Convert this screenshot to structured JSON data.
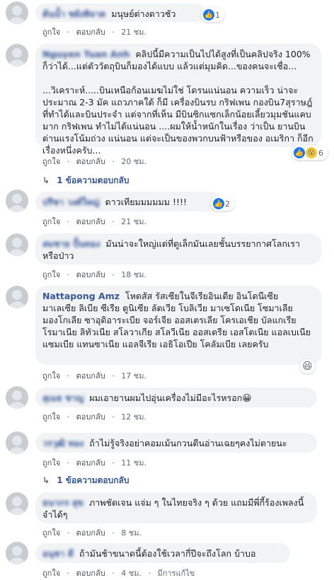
{
  "comments": [
    {
      "author": "ต้นน้ำ ชยังพิจาต",
      "text": "มนุษย์ต่างดาวชัว",
      "time": "21 ชม.",
      "reaction_count": "1"
    },
    {
      "author": "Nguyen Tuan Anh",
      "text": "คลิปนี้มีความเป็นไปได้สูงที่เป็นคลิปจริง 100% ก็ว่าได้...แต่ตัววัตถุบินก็มองได้แบบ แล้วแต่มุมคิด...ของคนจะเชื่อ...\n\n...วิเคราะห์.....บินเหนือก้อนเมฆไม่ใช่ โดรนแน่นอน ความเร็ว น่าจะประมาณ 2-3 มัค แถวภาคใต้ ก็มี เครื่องบินรบ กริฟเพน กองบิน7สุราษฎ์ ที่ทำได้และบินประจำ แต่จากที่เห็น มีบินซิกแซกเล็กน้อยเลี้ยวมุมชันแคบมาก กริฟเพน ทำไม่ได้แน่นอน ....ผมให้น้ำหนักในเรื่อง ว่าเป็น ยานบินต่านแรงโน้มถ่วง แน่นอน แต่จะเป็นของพวกบนฟ้าหรือของ อเมริกา ก็อีกเรื่องหนึ่งครับ...",
      "time": "20 ชม.",
      "reaction_count": "6",
      "replies": "1 ข้อความตอบกลับ"
    },
    {
      "author": "ปรีชา วงศ์ใหญ่",
      "text": "ดาวเทียมมมมมม !!!!",
      "time": "21 ชม.",
      "reaction_count": "2"
    },
    {
      "author": "สมชาย ปั้นทอง",
      "text": "มันน่าจะใหญ่แต่ที่ดูเล็กมันเลยชั้นบรรยากาศโลกเราหรือป่าว",
      "time": "18 ชม."
    },
    {
      "author": "Nattapong Amz",
      "text": "โหดสัส รัสเซียในจีเรียอินเดีย อินโดนีเซีย มาเลเซีย ลิเบีย ซีเรีย ตูนิเซีย ลัตเวีย โบลิเวีย มาเซโดเนีย โซมาเลีย มองโกเลีย ซาอุดิอาระเบีย จอร์เจีย ออสเตรเลีย โครเอเชีย บัลแกเรีย โรมาเนีย ลิทัวเนีย สโลวาเกีย สโลวีเนีย ออสเตรีย เอสโตเนีย แอลเบเนีย แซมเบีย แทนซาเนีย แอลจีเรีย เอธิโอเปีย โคลัมเบีย เลยครับ",
      "time": "17 ชม."
    },
    {
      "author": "สุเมธ ชาญ",
      "text": "ผมเอายานผมไปอุ่นเครื่องไม่มีอะไรหรอก😀",
      "time": "12 ชม."
    },
    {
      "author": "วรวุฒิ ทอง",
      "text": "ถ้าไม่รู้จริงอย่าคอมเม้นกวนตีนอ่านเฉยๆคงไม่ตายนะ",
      "time": "11 ชม.",
      "replies": "1 ข้อความตอบกลับ"
    },
    {
      "author": "ธนากร สุข",
      "text": "ภาพชัดเจน แจ่ม ๆ ในไทยจริง ๆ ด้วย แถมมีพี่กี้ร้องเพลงนี้ จำได้ๆ",
      "time": "8 ชม."
    },
    {
      "author": "อนุชา ดี",
      "text": "ถ้ามันช้าขนาดนี้ต้องใช้เวลากี่ปีจะถึงโลก บ้าบอ",
      "time": "4 ชม.",
      "edited": "มีการแก้ไข"
    }
  ],
  "actions": {
    "like": "ถูกใจ",
    "reply": "ตอบกลับ",
    "sep": "·"
  },
  "icons": {
    "like": "thumbs-up-icon",
    "wow": "wow-face-icon",
    "haha": "haha-face-icon",
    "reply": "reply-arrow-icon"
  },
  "colors": {
    "link": "#385898",
    "bubble": "#f2f3f5",
    "like": "#1877f2"
  }
}
